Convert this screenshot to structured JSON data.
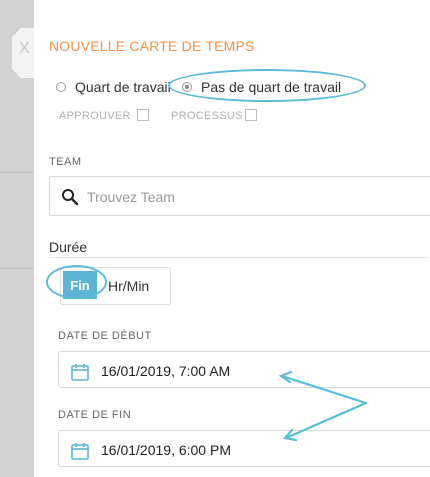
{
  "close_button": {
    "label": "X"
  },
  "form": {
    "title": "NOUVELLE CARTE DE TEMPS",
    "shift_options": [
      {
        "label": "Quart de travail",
        "selected": false
      },
      {
        "label": "Pas de quart de travail",
        "selected": true
      }
    ],
    "checkboxes": [
      {
        "label": "APPROUVER",
        "checked": false
      },
      {
        "label": "PROCESSUS",
        "checked": false
      }
    ],
    "team": {
      "label": "TEAM",
      "placeholder": "Trouvez Team",
      "value": ""
    },
    "duration": {
      "label": "Durée",
      "modes": [
        "Fin",
        "Hr/Min"
      ],
      "active_mode": "Fin"
    },
    "start_date": {
      "label": "DATE DE DÉBUT",
      "value": "16/01/2019, 7:00 AM"
    },
    "end_date": {
      "label": "DATE DE FIN",
      "value": "16/01/2019, 6:00 PM"
    }
  },
  "colors": {
    "title": "#f39149",
    "accent": "#5bb5d3",
    "annotation": "#5bbcd6",
    "calendar_icon": "#5bb5d3"
  }
}
